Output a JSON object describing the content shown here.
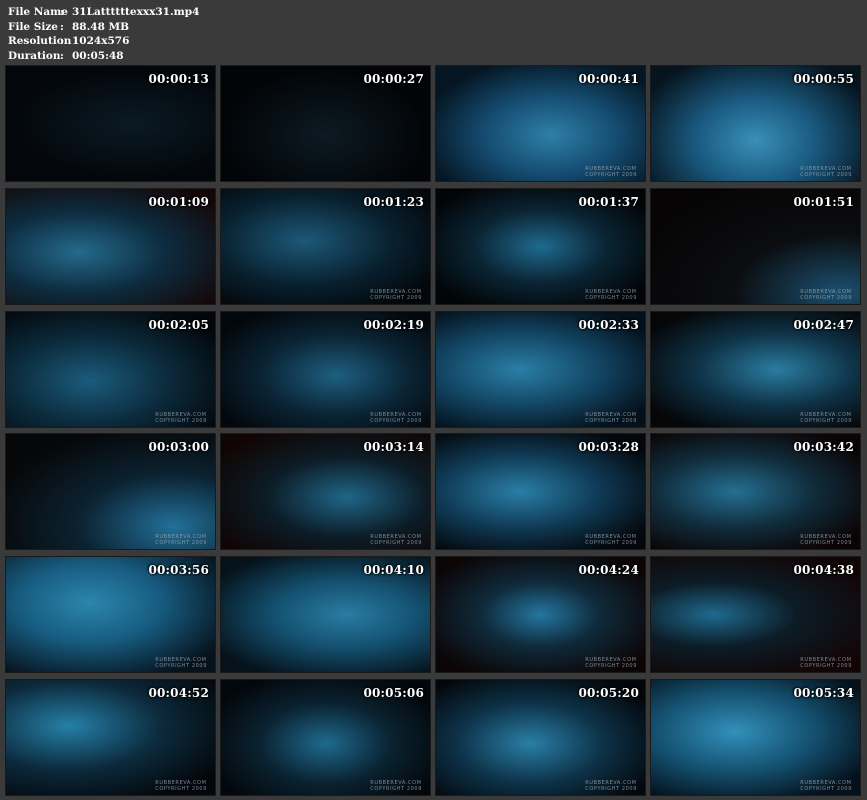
{
  "info": {
    "file_name": {
      "label": "File Name",
      "value": "31Lattttttexxx31.mp4"
    },
    "file_size": {
      "label": "File Size",
      "value": "88.48 MB"
    },
    "resolution": {
      "label": "Resolution",
      "value": "1024x576"
    },
    "duration": {
      "label": "Duration",
      "value": "00:05:48"
    },
    "separator": ":"
  },
  "watermark": {
    "line1": "RUBBEREVA.COM",
    "line2": "COPYRIGHT 2009"
  },
  "thumbnails": [
    {
      "time": "00:00:13"
    },
    {
      "time": "00:00:27"
    },
    {
      "time": "00:00:41"
    },
    {
      "time": "00:00:55"
    },
    {
      "time": "00:01:09"
    },
    {
      "time": "00:01:23"
    },
    {
      "time": "00:01:37"
    },
    {
      "time": "00:01:51"
    },
    {
      "time": "00:02:05"
    },
    {
      "time": "00:02:19"
    },
    {
      "time": "00:02:33"
    },
    {
      "time": "00:02:47"
    },
    {
      "time": "00:03:00"
    },
    {
      "time": "00:03:14"
    },
    {
      "time": "00:03:28"
    },
    {
      "time": "00:03:42"
    },
    {
      "time": "00:03:56"
    },
    {
      "time": "00:04:10"
    },
    {
      "time": "00:04:24"
    },
    {
      "time": "00:04:38"
    },
    {
      "time": "00:04:52"
    },
    {
      "time": "00:05:06"
    },
    {
      "time": "00:05:20"
    },
    {
      "time": "00:05:34"
    }
  ]
}
